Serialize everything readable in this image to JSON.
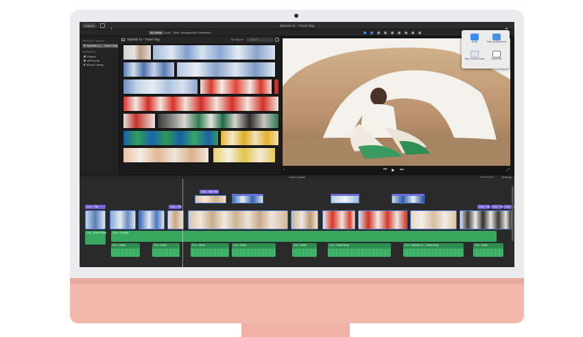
{
  "app": {
    "window_title": "Episode 12 – Travel Vlog",
    "projects_label": "Projects"
  },
  "media_tabs": [
    "My Media",
    "Audio",
    "Titles",
    "Backgrounds",
    "Transitions"
  ],
  "sidebar": {
    "project_media_heading": "PROJECT MEDIA",
    "project_item": "Episode 12 – Travel Vlog",
    "libraries_heading": "LIBRARIES",
    "items": [
      "Photos",
      "All Events",
      "iMovie Library"
    ]
  },
  "browser": {
    "title": "Episode 12 – Travel Vlog",
    "filter": "All Clips",
    "search_placeholder": "Search"
  },
  "share_menu": {
    "items": [
      "Email",
      "Save as Attachment",
      "Save Current Frame",
      "Export File"
    ]
  },
  "timeline": {
    "header": "Clone | Notes",
    "settings_label": "Settings",
    "title_clips": [
      "1.9s – Title",
      "3.4s – Title",
      "2.9s – Title",
      "2.0s – Title",
      "2.0s – Title"
    ],
    "top_title": "1.8s – Clip Title",
    "audio_main_label": "1.6s – Sound Effect",
    "audio_track_label": "0.1m – Episode",
    "audio_clip_labels": [
      "0.1s – Music",
      "0.1s – Music",
      "0.1s – Music",
      "0.1s – Music",
      "0.1s – Music",
      "0.1s – Travel Song",
      "0.1s – Episode 12 – Travel Song",
      "0.1s – Music"
    ]
  },
  "colors": {
    "imac_chin": "#f2b8ae",
    "clip_border": "#4f7ad8",
    "title_purple": "#7466d8",
    "audio_green": "#3aa760",
    "accent_blue": "#3b8cf5"
  }
}
